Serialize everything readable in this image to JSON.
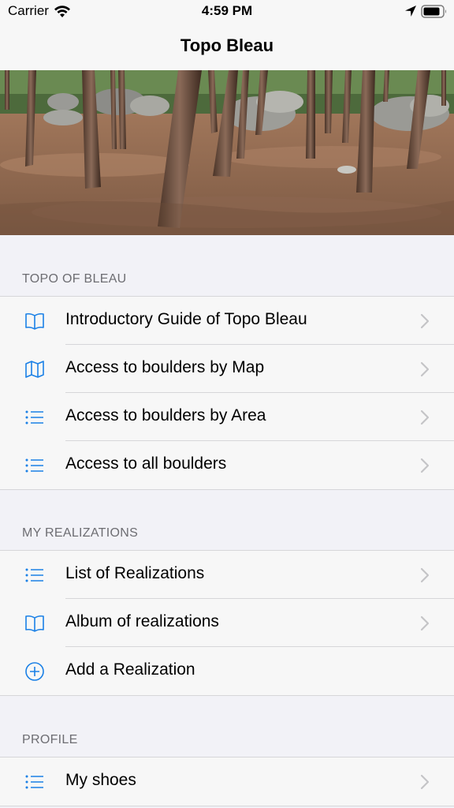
{
  "status_bar": {
    "carrier": "Carrier",
    "time": "4:59 PM"
  },
  "nav": {
    "title": "Topo Bleau"
  },
  "accent_color": "#1a80e6",
  "sections": {
    "topo": {
      "header": "TOPO OF BLEAU",
      "items": [
        {
          "label": "Introductory Guide of Topo Bleau",
          "icon": "book-icon"
        },
        {
          "label": "Access to boulders by Map",
          "icon": "map-icon"
        },
        {
          "label": "Access to boulders by Area",
          "icon": "list-icon"
        },
        {
          "label": "Access to all boulders",
          "icon": "list-icon"
        }
      ]
    },
    "realizations": {
      "header": "MY REALIZATIONS",
      "items": [
        {
          "label": "List of Realizations",
          "icon": "list-icon"
        },
        {
          "label": "Album of realizations",
          "icon": "book-icon"
        },
        {
          "label": "Add a Realization",
          "icon": "plus-circle-icon"
        }
      ]
    },
    "profile": {
      "header": "PROFILE",
      "items": [
        {
          "label": "My shoes",
          "icon": "list-icon"
        }
      ]
    }
  }
}
